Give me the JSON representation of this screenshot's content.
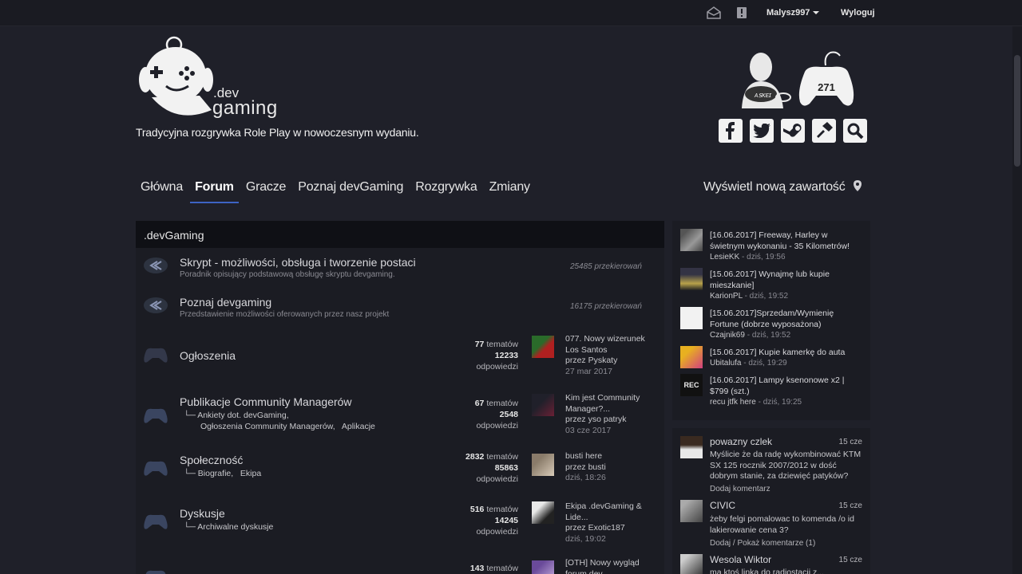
{
  "topbar": {
    "username": "Malysz997",
    "logout": "Wyloguj",
    "icons": [
      "inbox-icon",
      "notification-icon"
    ]
  },
  "header": {
    "logo_dev": ".dev",
    "logo_gaming": "gaming",
    "tagline": "Tradycyjna rozgrywka Role Play w nowoczesnym wydaniu.",
    "online_count": "271",
    "social": [
      "facebook-icon",
      "twitter-icon",
      "steam-icon",
      "hammer-icon",
      "search-icon"
    ]
  },
  "nav": {
    "items": [
      {
        "label": "Główna"
      },
      {
        "label": "Forum"
      },
      {
        "label": "Gracze"
      },
      {
        "label": "Poznaj devGaming"
      },
      {
        "label": "Rozgrywka"
      },
      {
        "label": "Zmiany"
      }
    ],
    "active": "Forum",
    "new_content": "Wyświetl nową zawartość"
  },
  "forum": {
    "category": ".devGaming",
    "rows": [
      {
        "title": "Skrypt - możliwości, obsługa i tworzenie postaci",
        "desc": "Poradnik opisujący podstawową obsługę skryptu devgaming.",
        "redirects": "25485 przekierowań"
      },
      {
        "title": "Poznaj devgaming",
        "desc": "Przedstawienie możliwości oferowanych przez nasz projekt",
        "redirects": "16175 przekierowań"
      },
      {
        "title": "Ogłoszenia",
        "topics": "77",
        "topics_label": "tematów",
        "replies": "12233",
        "replies_label": "odpowiedzi",
        "last_title": "077. Nowy wizerunek Los Santos",
        "last_by": "przez Pyskaty",
        "last_date": "27 mar 2017"
      },
      {
        "title": "Publikacje Community Managerów",
        "sub1": "Ankiety dot. devGaming,",
        "sub2a": "Ogłoszenia Community Managerów,",
        "sub2b": "Aplikacje",
        "topics": "67",
        "topics_label": "tematów",
        "replies": "2548",
        "replies_label": "odpowiedzi",
        "last_title": "Kim jest Community Manager?...",
        "last_by": "przez yso patryk",
        "last_date": "03 cze 2017"
      },
      {
        "title": "Społeczność",
        "sub1a": "Biografie,",
        "sub1b": "Ekipa",
        "topics": "2832",
        "topics_label": "tematów",
        "replies": "85863",
        "replies_label": "odpowiedzi",
        "last_title": "busti here",
        "last_by": "przez busti",
        "last_date": "dziś, 18:26"
      },
      {
        "title": "Dyskusje",
        "sub1": "Archiwalne dyskusje",
        "topics": "516",
        "topics_label": "tematów",
        "replies": "14245",
        "replies_label": "odpowiedzi",
        "last_title": "Ekipa .devGaming & Lide...",
        "last_by": "przez Exotic187",
        "last_date": "dziś, 19:02"
      },
      {
        "topics": "143",
        "topics_label": "tematów",
        "last_title": "[OTH] Nowy wygląd forum dev..."
      }
    ]
  },
  "recent": [
    {
      "title": "[16.06.2017] Freeway, Harley w świetnym wykonaniu - 35 Kilometrów!",
      "user": "LesieKK",
      "time": "dziś, 19:56"
    },
    {
      "title": "[15.06.2017] Wynajmę lub kupie mieszkanie]",
      "user": "KarionPL",
      "time": "dziś, 19:52"
    },
    {
      "title": "[15.06.2017]Sprzedam/Wymienię Fortune (dobrze wyposażona)",
      "user": "Czajnik69",
      "time": "dziś, 19:52"
    },
    {
      "title": "[15.06.2017] Kupie kamerkę do auta",
      "user": "Ubitalufa",
      "time": "dziś, 19:29"
    },
    {
      "title": "[16.06.2017] Lampy ksenonowe x2 | $799 (szt.)",
      "user": "recu jtfk here",
      "time": "dziś, 19:25"
    }
  ],
  "comments": [
    {
      "name": "powazny czlek",
      "date": "15 cze",
      "body": "Myślicie że da radę wykombinować KTM SX 125 rocznik 2007/2012 w dość dobrym stanie, za dziewięć patyków?",
      "action": "Dodaj komentarz"
    },
    {
      "name": "CIVIC",
      "date": "15 cze",
      "body": "żeby felgi pomalowac to komenda /o id lakierowanie cena 3?",
      "action": "Dodaj / Pokaż komentarze (1)"
    },
    {
      "name": "Wesola Wiktor",
      "date": "15 cze",
      "body": "ma ktoś linka do radiostacji z..."
    }
  ],
  "colors": {
    "accent": "#3d63c4",
    "bg": "#1f2029",
    "panel": "#1b1c23"
  }
}
